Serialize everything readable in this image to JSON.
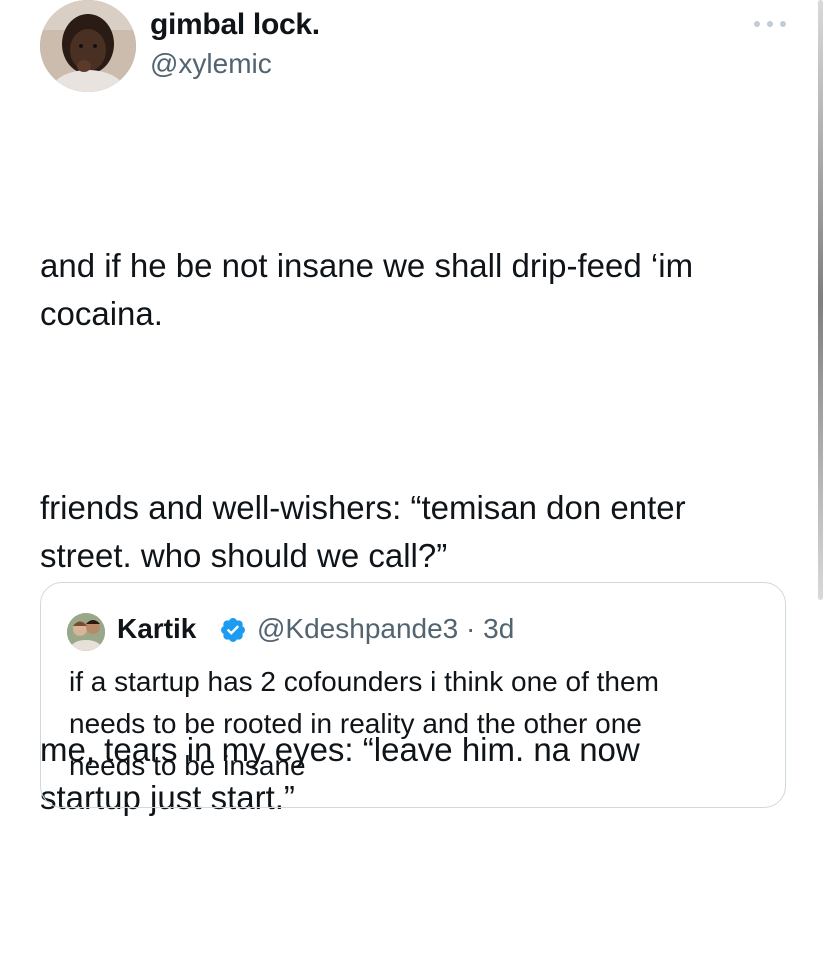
{
  "author": {
    "display_name": "gimbal lock.",
    "handle": "@xylemic"
  },
  "tweet": {
    "paragraphs": [
      "and if he be not insane we shall drip-feed ‘im\ncocaina.",
      "friends and well-wishers: “temisan don enter\nstreet. who should we call?”",
      "me, tears in my eyes: “leave him. na now\nstartup just start.”"
    ]
  },
  "quoted_tweet": {
    "display_name": "Kartik",
    "handle_and_time": "@Kdeshpande3 · 3d",
    "text": "if a startup has 2 cofounders i think one of them\nneeds to be rooted in reality and the other one\nneeds to be insane"
  },
  "icons": {
    "more": "more-icon",
    "verified": "verified-badge-icon"
  },
  "colors": {
    "text": "#0f1419",
    "secondary": "#536471",
    "verified": "#1d9bf0",
    "border": "#cfd9de"
  }
}
